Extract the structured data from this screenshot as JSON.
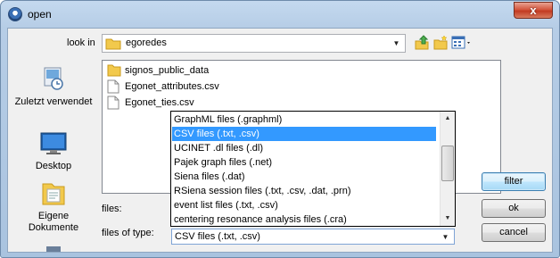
{
  "window": {
    "title": "open",
    "close_label": "x"
  },
  "toolbar": {
    "lookin_label": "look in",
    "lookin_value": "egoredes",
    "icons": [
      "up-folder-icon",
      "new-folder-icon",
      "view-menu-icon"
    ]
  },
  "places": [
    {
      "label": "Zuletzt verwendet",
      "icon": "recent-places-icon"
    },
    {
      "label": "Desktop",
      "icon": "desktop-icon"
    },
    {
      "label": "Eigene Dokumente",
      "icon": "documents-icon"
    }
  ],
  "files": [
    {
      "name": "signos_public_data",
      "icon": "folder-icon"
    },
    {
      "name": "Egonet_attributes.csv",
      "icon": "file-icon"
    },
    {
      "name": "Egonet_ties.csv",
      "icon": "file-icon"
    }
  ],
  "form": {
    "files_label": "files:",
    "types_label": "files of type:",
    "types_value": "CSV files (.txt, .csv)"
  },
  "dropdown": {
    "items": [
      "GraphML files (.graphml)",
      "CSV files (.txt, .csv)",
      "UCINET .dl files (.dl)",
      "Pajek graph files (.net)",
      "Siena files (.dat)",
      "RSiena session files (.txt, .csv, .dat, .prn)",
      "event list files (.txt, .csv)",
      "centering resonance analysis files (.cra)"
    ],
    "selected_index": 1
  },
  "buttons": {
    "filter": "filter",
    "ok": "ok",
    "cancel": "cancel"
  },
  "colors": {
    "selection": "#3399ff",
    "titlebar": "#b9d1ea",
    "close": "#c7432a"
  }
}
